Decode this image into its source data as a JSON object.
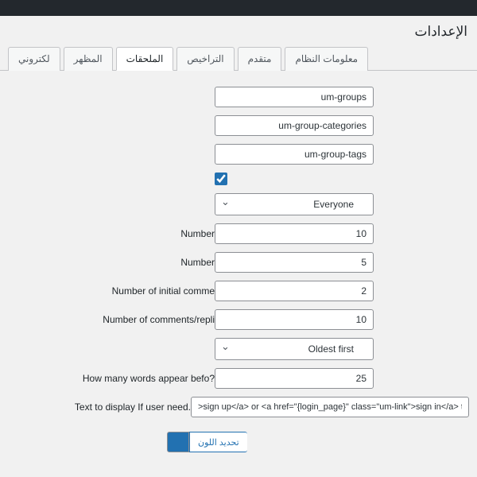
{
  "header": {
    "title": "الإعدادات"
  },
  "tabs": [
    "لكتروني",
    "المظهر",
    "الملحقات",
    "التراخيص",
    "متقدم",
    "معلومات النظام"
  ],
  "fields": {
    "slug1": {
      "value": "um-groups"
    },
    "slug2": {
      "value": "um-group-categories"
    },
    "slug3": {
      "value": "um-group-tags"
    },
    "visibility": {
      "value": "Everyone"
    },
    "num1": {
      "label": "Number",
      "value": "10"
    },
    "num2": {
      "label": "Number",
      "value": "5"
    },
    "num3": {
      "label": "Number of initial comme",
      "value": "2"
    },
    "num4": {
      "label": "Number of comments/repli",
      "value": "10"
    },
    "order": {
      "value": "Oldest first"
    },
    "words": {
      "label": "?How many words appear befo",
      "value": "25"
    },
    "logintext": {
      "label": ".Text to display If user need",
      "value": ">sign up</a> or <a href=\"{login_page}\" class=\"um-link\">sign in</a> to see group activity"
    },
    "color": {
      "button": "تحديد اللون",
      "swatch": "#2271b1"
    }
  }
}
